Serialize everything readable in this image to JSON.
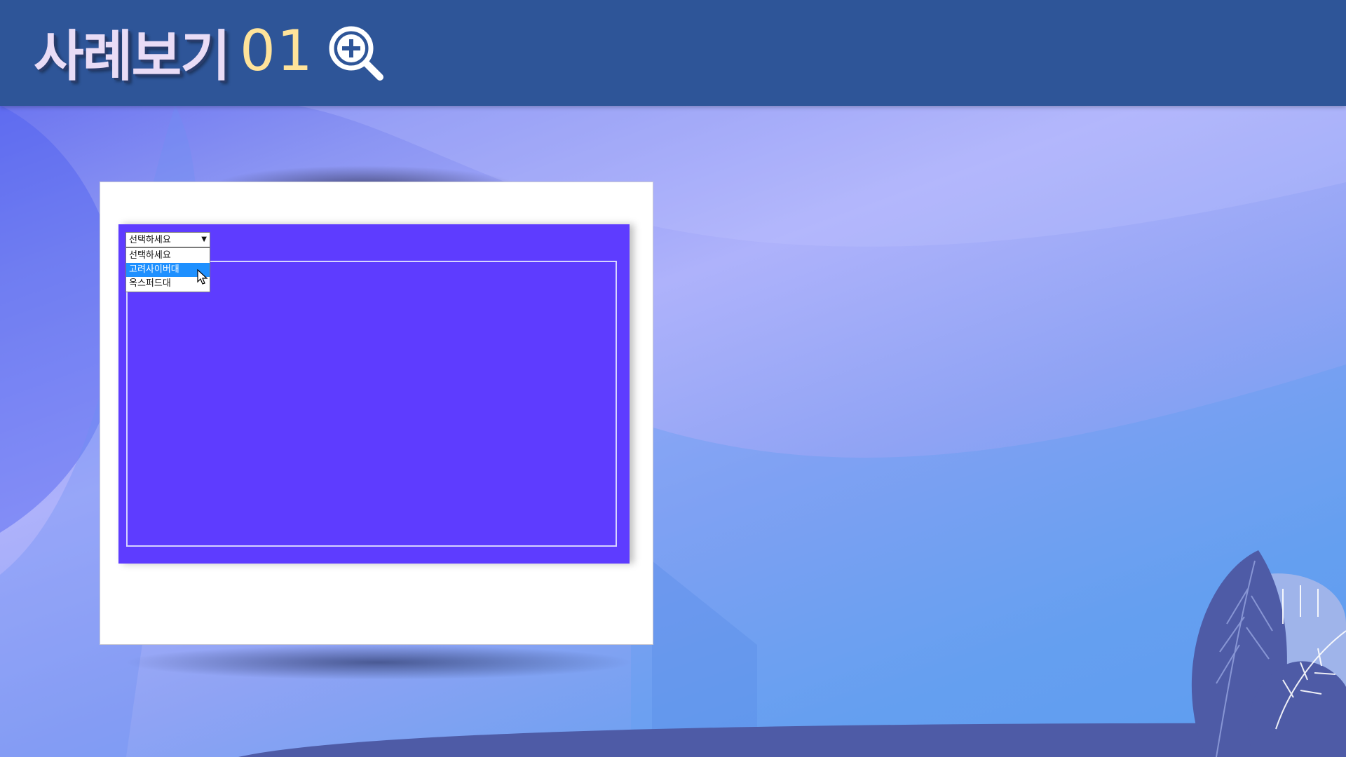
{
  "header": {
    "title": "사례보기",
    "number": "01",
    "zoom_icon": "zoom-in-icon"
  },
  "dropdown": {
    "current_value": "선택하세요",
    "arrow": "▼",
    "options": [
      {
        "label": "선택하세요",
        "selected": false
      },
      {
        "label": "고려사이버대",
        "selected": true
      },
      {
        "label": "옥스퍼드대",
        "selected": false
      }
    ]
  },
  "colors": {
    "header_bg": "#2e5598",
    "title_text": "#e9dcf6",
    "number_text": "#ffe39a",
    "screen_bg": "#5e3cff",
    "option_highlight": "#1e90ff",
    "plant_dark": "#4e5ba6",
    "plant_light": "#9fb4ea"
  }
}
